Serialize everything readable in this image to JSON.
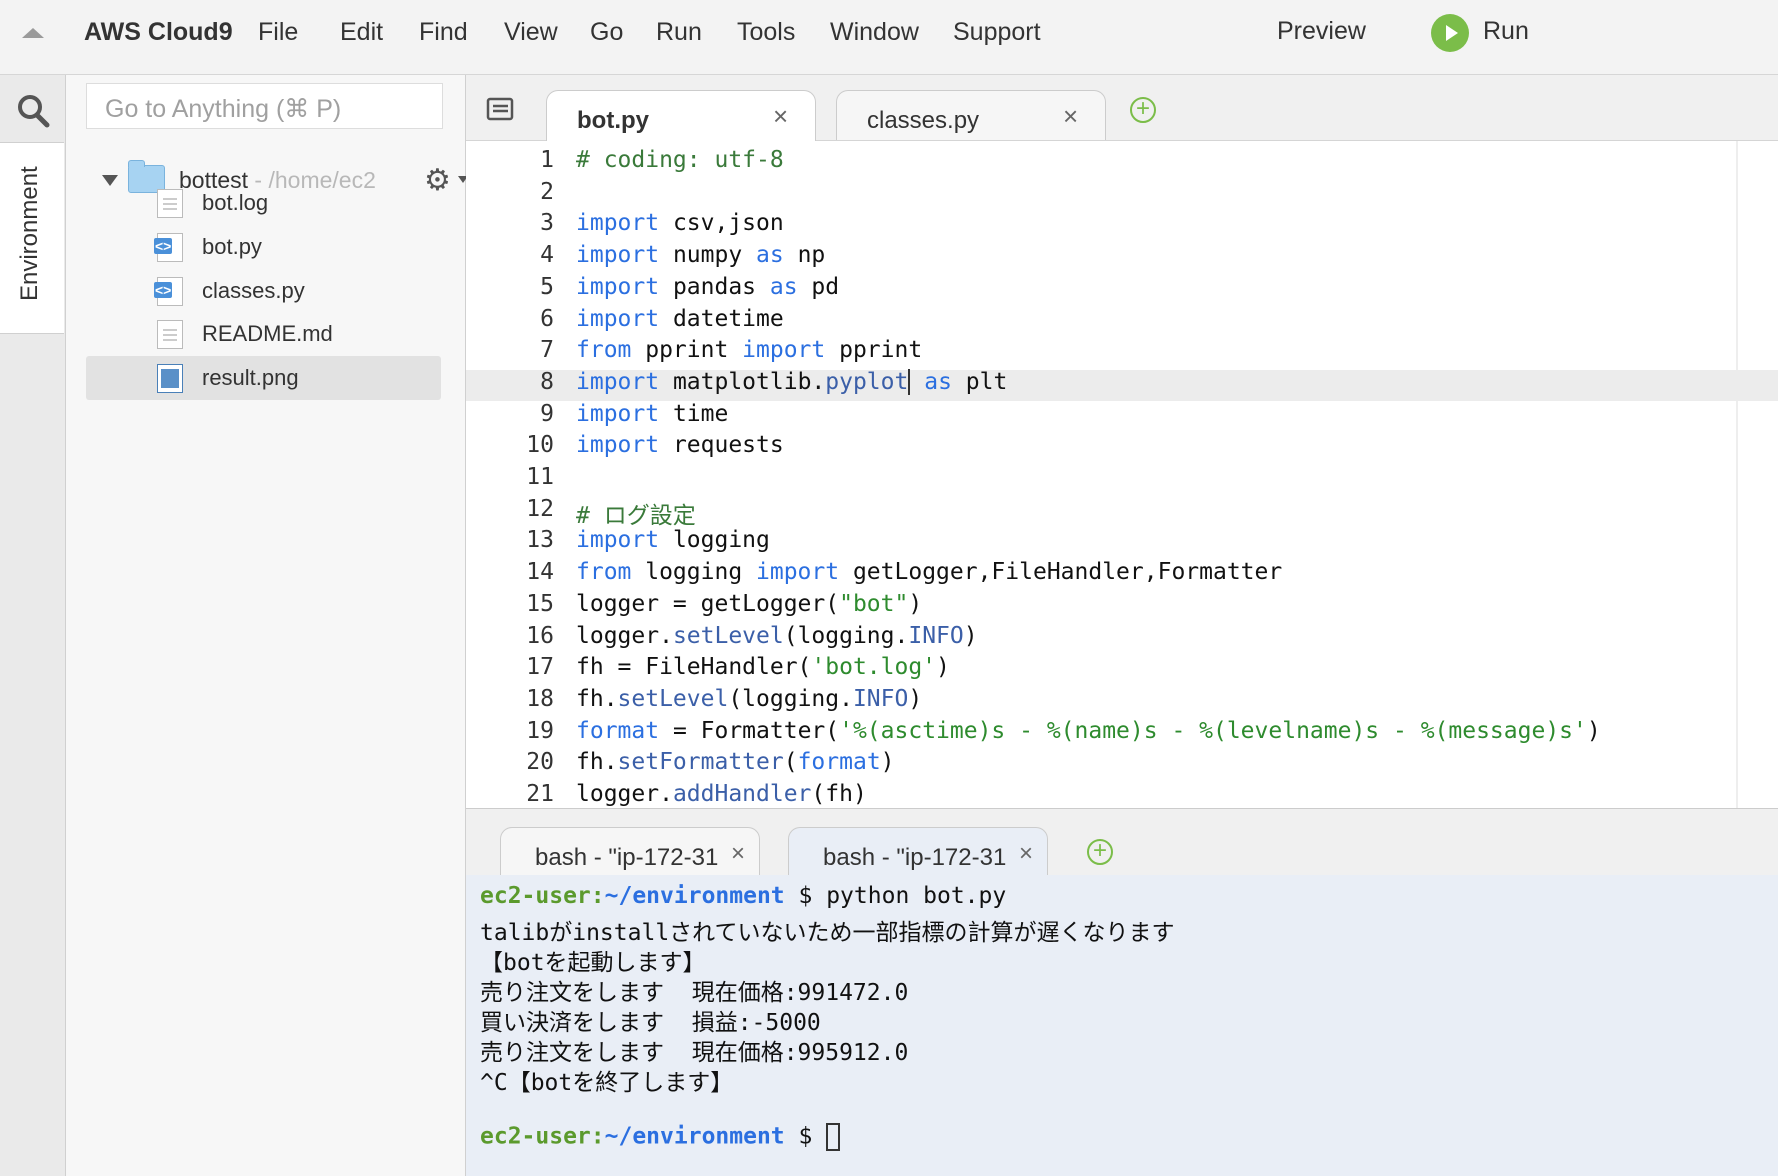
{
  "menubar": {
    "brand": "AWS Cloud9",
    "items": [
      "File",
      "Edit",
      "Find",
      "View",
      "Go",
      "Run",
      "Tools",
      "Window",
      "Support"
    ],
    "preview": "Preview",
    "run": "Run"
  },
  "sidebar": {
    "env_tab": "Environment",
    "search_placeholder": "Go to Anything (⌘ P)",
    "root": {
      "name": "bottest",
      "path": " - /home/ec2"
    },
    "files": [
      {
        "name": "bot.log",
        "icon": "text-file-icon"
      },
      {
        "name": "bot.py",
        "icon": "python-file-icon"
      },
      {
        "name": "classes.py",
        "icon": "python-file-icon"
      },
      {
        "name": "README.md",
        "icon": "text-file-icon"
      },
      {
        "name": "result.png",
        "icon": "image-file-icon",
        "selected": true
      }
    ]
  },
  "editor": {
    "tabs": [
      {
        "label": "bot.py",
        "active": true
      },
      {
        "label": "classes.py",
        "active": false
      }
    ],
    "active_line": 8,
    "lines": [
      "1",
      "2",
      "3",
      "4",
      "5",
      "6",
      "7",
      "8",
      "9",
      "10",
      "11",
      "12",
      "13",
      "14",
      "15",
      "16",
      "17",
      "18",
      "19",
      "20",
      "21"
    ],
    "code": [
      "# coding: utf-8",
      "",
      "import csv,json",
      "import numpy as np",
      "import pandas as pd",
      "import datetime",
      "from pprint import pprint",
      "import matplotlib.pyplot as plt",
      "import time",
      "import requests",
      "",
      "# ログ設定",
      "import logging",
      "from logging import getLogger,FileHandler,Formatter",
      "logger = getLogger(\"bot\")",
      "logger.setLevel(logging.INFO)",
      "fh = FileHandler('bot.log')",
      "fh.setLevel(logging.INFO)",
      "format = Formatter('%(asctime)s - %(name)s - %(levelname)s - %(message)s')",
      "fh.setFormatter(format)",
      "logger.addHandler(fh)"
    ]
  },
  "terminal": {
    "tabs": [
      {
        "label": "bash - \"ip-172-31",
        "active": false
      },
      {
        "label": "bash - \"ip-172-31",
        "active": true
      }
    ],
    "prompt_user": "ec2-user",
    "prompt_colon": ":",
    "prompt_path": "~/environment",
    "prompt_symbol": " $ ",
    "command": "python bot.py",
    "output": [
      "talibがinstallされていないため一部指標の計算が遅くなります",
      "【botを起動します】",
      "売り注文をします  現在価格:991472.0",
      "買い決済をします  損益:-5000",
      "売り注文をします  現在価格:995912.0",
      "^C【botを終了します】"
    ]
  },
  "colors": {
    "keyword": "#2b6fe0",
    "comment": "#3a7a3a",
    "string": "#2e8b2e",
    "run_green": "#7bbd49",
    "terminal_bg": "#e9eef6"
  }
}
